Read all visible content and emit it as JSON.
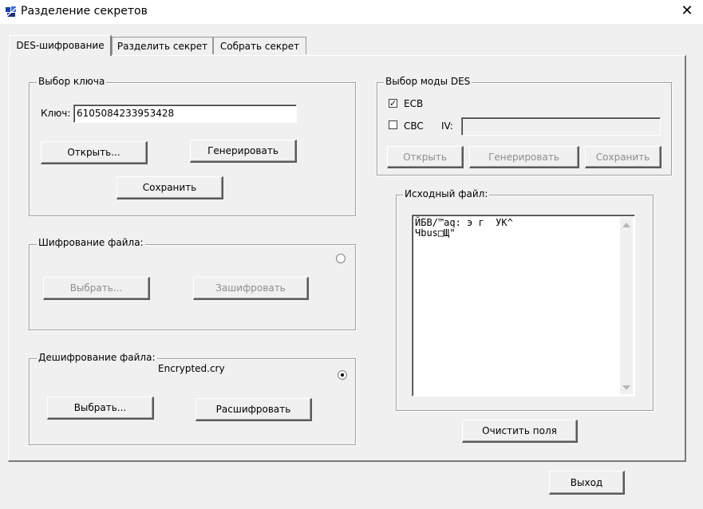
{
  "window": {
    "title": "Разделение секретов",
    "close_symbol": "✕"
  },
  "tabs": [
    {
      "label": "DES-шифрование",
      "active": true
    },
    {
      "label": "Разделить секрет",
      "active": false
    },
    {
      "label": "Собрать секрет",
      "active": false
    }
  ],
  "key_group": {
    "legend": "Выбор ключа",
    "key_label": "Ключ:",
    "key_value": "6105084233953428",
    "open_label": "Открыть...",
    "generate_label": "Генерировать",
    "save_label": "Сохранить"
  },
  "encrypt_group": {
    "legend": "Шифрование файла:",
    "choose_label": "Выбрать...",
    "encrypt_label": "Зашифровать",
    "selected": false
  },
  "decrypt_group": {
    "legend": "Дешифрование файла:",
    "filename": "Encrypted.cry",
    "choose_label": "Выбрать...",
    "decrypt_label": "Расшифровать",
    "selected": true
  },
  "mode_group": {
    "legend": "Выбор моды DES",
    "ecb_label": "ECB",
    "ecb_checked": true,
    "cbc_label": "CBC",
    "cbc_checked": false,
    "iv_label": "IV:",
    "iv_value": "",
    "open_label": "Открыть",
    "generate_label": "Генерировать",
    "save_label": "Сохранить"
  },
  "source_group": {
    "legend": "Исходный файл:",
    "content_line1": "ЙБВ/™aq: э г  УК^",
    "content_line2": "Чbus□Щ\"",
    "clear_label": "Очистить поля"
  },
  "exit_label": "Выход",
  "icons": {
    "app": "app-icon",
    "close": "close-icon",
    "scroll_up": "scroll-up-icon",
    "scroll_down": "scroll-down-icon"
  }
}
